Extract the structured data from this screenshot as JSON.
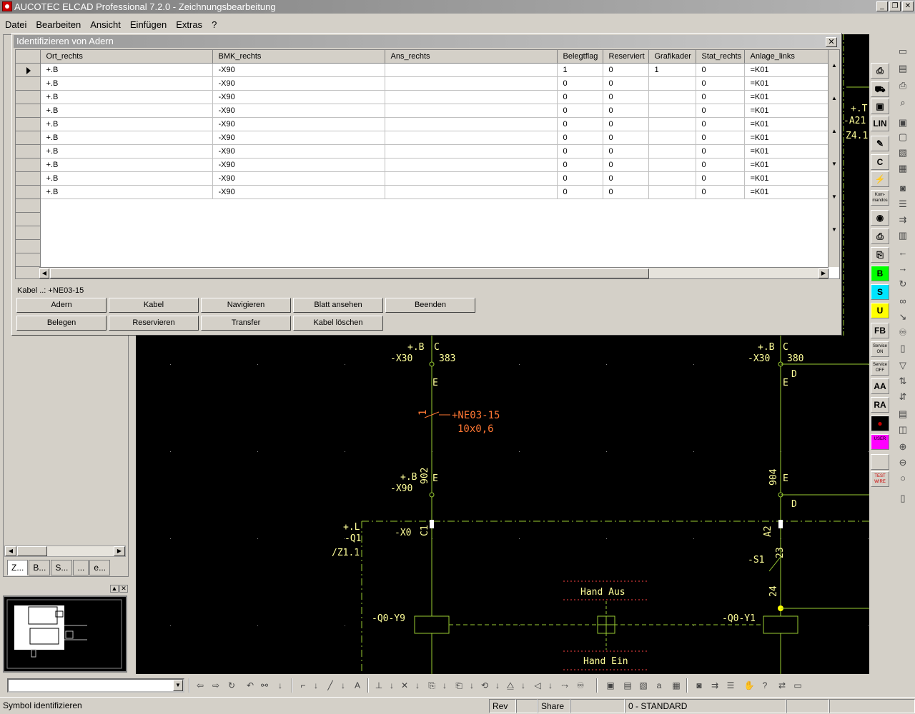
{
  "window": {
    "title": "AUCOTEC ELCAD Professional 7.2.0 - Zeichnungsbearbeitung",
    "controls": [
      "_",
      "❐",
      "✕"
    ]
  },
  "menu": [
    {
      "label": "Datei"
    },
    {
      "label": "Bearbeiten"
    },
    {
      "label": "Ansicht"
    },
    {
      "label": "Einfügen"
    },
    {
      "label": "Extras"
    },
    {
      "label": "?"
    }
  ],
  "dialog": {
    "title": "Identifizieren von Adern",
    "close": "✕",
    "columns": [
      "Ort_rechts",
      "BMK_rechts",
      "Ans_rechts",
      "Belegtflag",
      "Reserviert",
      "Grafikader",
      "Stat_rechts",
      "Anlage_links"
    ],
    "rows": [
      [
        "+.B",
        "-X90",
        "",
        "1",
        "0",
        "1",
        "0",
        "=K01"
      ],
      [
        "+.B",
        "-X90",
        "",
        "0",
        "0",
        "",
        "0",
        "=K01"
      ],
      [
        "+.B",
        "-X90",
        "",
        "0",
        "0",
        "",
        "0",
        "=K01"
      ],
      [
        "+.B",
        "-X90",
        "",
        "0",
        "0",
        "",
        "0",
        "=K01"
      ],
      [
        "+.B",
        "-X90",
        "",
        "0",
        "0",
        "",
        "0",
        "=K01"
      ],
      [
        "+.B",
        "-X90",
        "",
        "0",
        "0",
        "",
        "0",
        "=K01"
      ],
      [
        "+.B",
        "-X90",
        "",
        "0",
        "0",
        "",
        "0",
        "=K01"
      ],
      [
        "+.B",
        "-X90",
        "",
        "0",
        "0",
        "",
        "0",
        "=K01"
      ],
      [
        "+.B",
        "-X90",
        "",
        "0",
        "0",
        "",
        "0",
        "=K01"
      ],
      [
        "+.B",
        "-X90",
        "",
        "0",
        "0",
        "",
        "0",
        "=K01"
      ]
    ],
    "empty_rows": 6,
    "kabel_label": "Kabel ..: +NE03-15",
    "buttons_row1": [
      "Adern",
      "Kabel",
      "Navigieren",
      "Blatt ansehen",
      "Beenden"
    ],
    "buttons_row2": [
      "Belegen",
      "Reservieren",
      "Transfer",
      "Kabel löschen"
    ]
  },
  "left_panel": {
    "tabs": [
      "Z...",
      "B...",
      "S...",
      "...",
      "e..."
    ]
  },
  "right_toolbar": [
    {
      "label": "",
      "icon": "printer-icon"
    },
    {
      "label": "",
      "icon": "car-icon"
    },
    {
      "label": "",
      "icon": "stamp-icon"
    },
    {
      "label": "LIN",
      "icon": ""
    },
    {
      "label": "",
      "icon": "pencil-icon"
    },
    {
      "label": "C",
      "icon": ""
    },
    {
      "label": "",
      "icon": "antenna-icon"
    },
    {
      "label": "Kom-\nmandos",
      "icon": ""
    },
    {
      "label": "",
      "icon": "disk-icon"
    },
    {
      "label": "",
      "icon": "printer2-icon"
    },
    {
      "label": "",
      "icon": "copy-icon"
    },
    {
      "label": "B",
      "icon": "",
      "color": "#00ff00"
    },
    {
      "label": "S",
      "icon": "",
      "color": "#00e5ff"
    },
    {
      "label": "U",
      "icon": "",
      "color": "#ffff00"
    },
    {
      "label": "FB",
      "icon": ""
    },
    {
      "label": "Service\nON",
      "icon": ""
    },
    {
      "label": "Service\nOFF",
      "icon": ""
    },
    {
      "label": "AA",
      "icon": ""
    },
    {
      "label": "RA",
      "icon": ""
    },
    {
      "label": "",
      "icon": "record-icon"
    },
    {
      "label": "USER",
      "icon": "",
      "color": "#ff00ff"
    },
    {
      "label": "",
      "icon": ""
    },
    {
      "label": "TEST\nWIRE",
      "icon": ""
    }
  ],
  "drawing": {
    "strip_labels": [
      "+.T",
      "-A21",
      "Z4.1"
    ],
    "labels": [
      {
        "text": "+.B",
        "color": "#ffff99"
      },
      {
        "text": "-X30",
        "color": "#ffff99"
      },
      {
        "text": "C",
        "color": "#ffff99"
      },
      {
        "text": "383",
        "color": "#ffff99"
      },
      {
        "text": "E",
        "color": "#ffff99"
      },
      {
        "text": "+NE03-15",
        "color": "#ff7733"
      },
      {
        "text": "10x0,6",
        "color": "#ff7733"
      },
      {
        "text": "1",
        "color": "#ff7733"
      },
      {
        "text": "+.B",
        "color": "#ffff99"
      },
      {
        "text": "-X90",
        "color": "#ffff99"
      },
      {
        "text": "902",
        "color": "#ffff99"
      },
      {
        "text": "E",
        "color": "#ffff99"
      },
      {
        "text": "+.L",
        "color": "#ffff99"
      },
      {
        "text": "-Q1",
        "color": "#ffff99"
      },
      {
        "text": "/Z1.1",
        "color": "#ffff99"
      },
      {
        "text": "-X0",
        "color": "#ffff99"
      },
      {
        "text": "C1",
        "color": "#ffff99"
      },
      {
        "text": "-Q0-Y9",
        "color": "#ffff99"
      },
      {
        "text": "Hand Aus",
        "color": "#ffff99"
      },
      {
        "text": "Hand Ein",
        "color": "#ffff99"
      },
      {
        "text": "+.B",
        "color": "#ffff99"
      },
      {
        "text": "-X30",
        "color": "#ffff99"
      },
      {
        "text": "C",
        "color": "#ffff99"
      },
      {
        "text": "380",
        "color": "#ffff99"
      },
      {
        "text": "D",
        "color": "#ffff99"
      },
      {
        "text": "E",
        "color": "#ffff99"
      },
      {
        "text": "904",
        "color": "#ffff99"
      },
      {
        "text": "E",
        "color": "#ffff99"
      },
      {
        "text": "D",
        "color": "#ffff99"
      },
      {
        "text": "A2",
        "color": "#ffff99"
      },
      {
        "text": "-S1",
        "color": "#ffff99"
      },
      {
        "text": "23",
        "color": "#ffff99"
      },
      {
        "text": "24",
        "color": "#ffff99"
      },
      {
        "text": "-Q0-Y1",
        "color": "#ffff99"
      }
    ]
  },
  "status": {
    "message": "Symbol identifizieren",
    "rev": "Rev",
    "share": "Share",
    "layer": "0 - STANDARD"
  }
}
